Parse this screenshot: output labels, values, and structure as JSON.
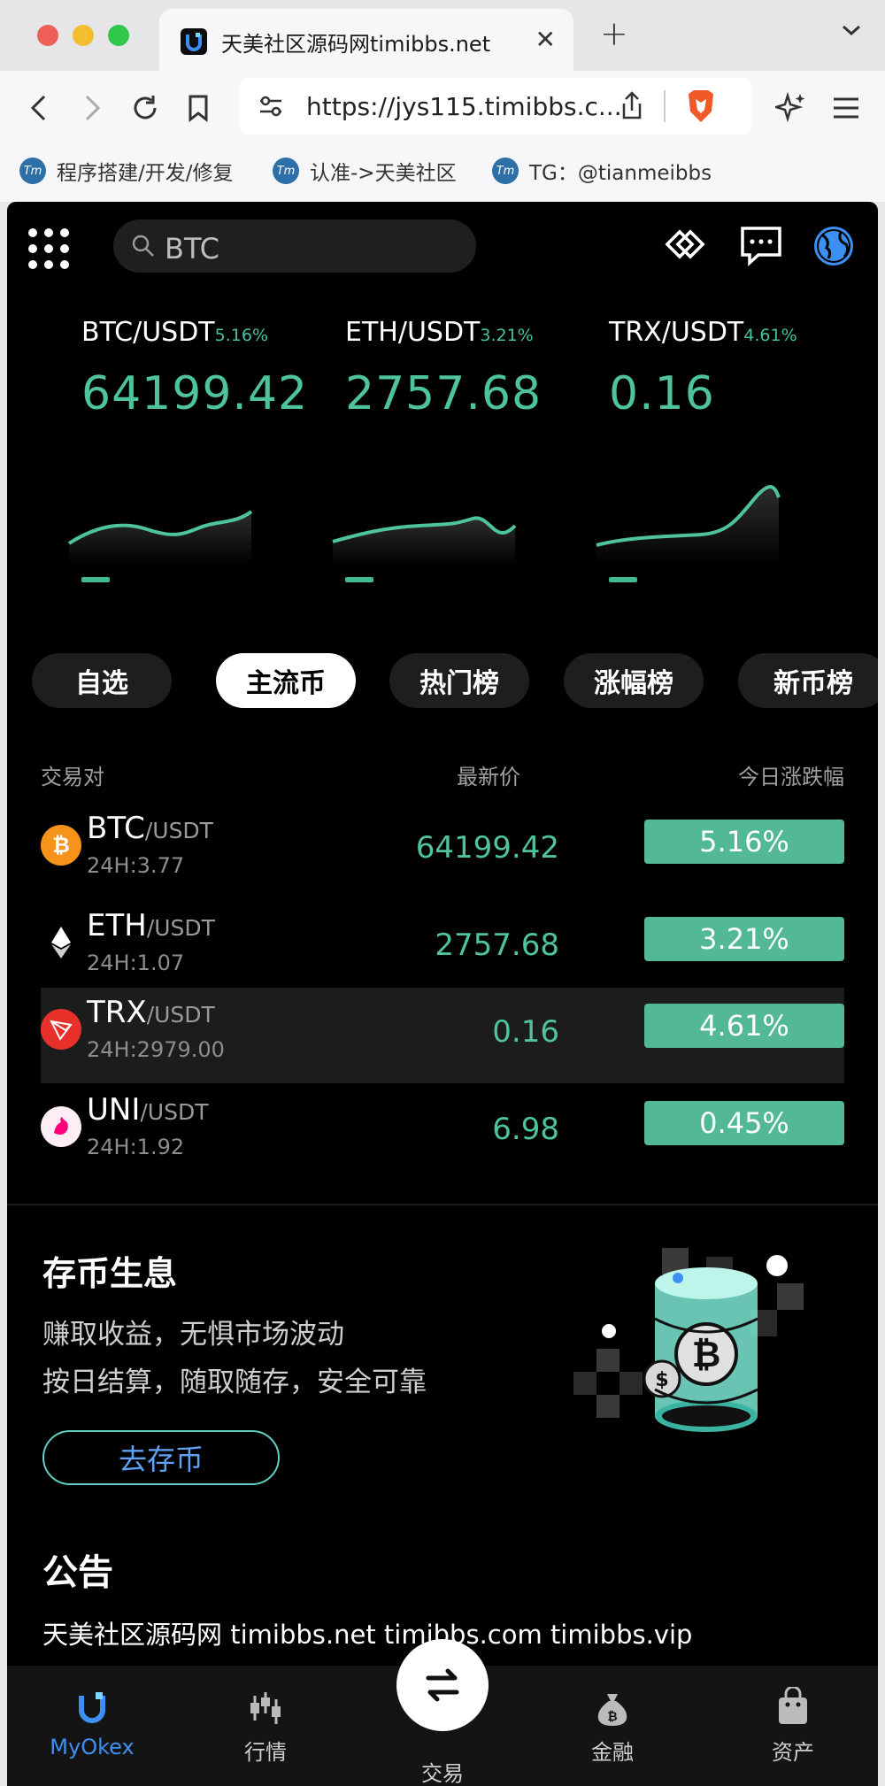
{
  "browser": {
    "tab_title": "天美社区源码网timibbs.net",
    "url": "https://jys115.timibbs.c...",
    "bookmarks": [
      {
        "label": "程序搭建/开发/修复"
      },
      {
        "label": "认准->天美社区"
      },
      {
        "label": "TG：@tianmeibbs"
      }
    ]
  },
  "header": {
    "search_value": "BTC"
  },
  "tickers": [
    {
      "pair": "BTC/USDT",
      "change": "5.16%",
      "price": "64199.42"
    },
    {
      "pair": "ETH/USDT",
      "change": "3.21%",
      "price": "2757.68"
    },
    {
      "pair": "TRX/USDT",
      "change": "4.61%",
      "price": "0.16"
    }
  ],
  "categories": [
    {
      "label": "自选",
      "active": false
    },
    {
      "label": "主流币",
      "active": true
    },
    {
      "label": "热门榜",
      "active": false
    },
    {
      "label": "涨幅榜",
      "active": false
    },
    {
      "label": "新币榜",
      "active": false
    }
  ],
  "table": {
    "col_pair": "交易对",
    "col_price": "最新价",
    "col_change": "今日涨跌幅",
    "rows": [
      {
        "base": "BTC",
        "quote": "/USDT",
        "vol": "24H:3.77",
        "price": "64199.42",
        "change": "5.16%"
      },
      {
        "base": "ETH",
        "quote": "/USDT",
        "vol": "24H:1.07",
        "price": "2757.68",
        "change": "3.21%"
      },
      {
        "base": "TRX",
        "quote": "/USDT",
        "vol": "24H:2979.00",
        "price": "0.16",
        "change": "4.61%"
      },
      {
        "base": "UNI",
        "quote": "/USDT",
        "vol": "24H:1.92",
        "price": "6.98",
        "change": "0.45%"
      }
    ]
  },
  "savings": {
    "title": "存币生息",
    "line1": "赚取收益，无惧市场波动",
    "line2": "按日结算，随取随存，安全可靠",
    "button": "去存币"
  },
  "notice": {
    "title": "公告",
    "text": "天美社区源码网 timibbs.net timibbs.com timibbs.vip"
  },
  "bottom_nav": {
    "home": "MyOkex",
    "market": "行情",
    "trade": "交易",
    "finance": "金融",
    "assets": "资产"
  },
  "colors": {
    "up_green": "#52b895",
    "accent_blue": "#3d90f3",
    "background": "#000000"
  }
}
